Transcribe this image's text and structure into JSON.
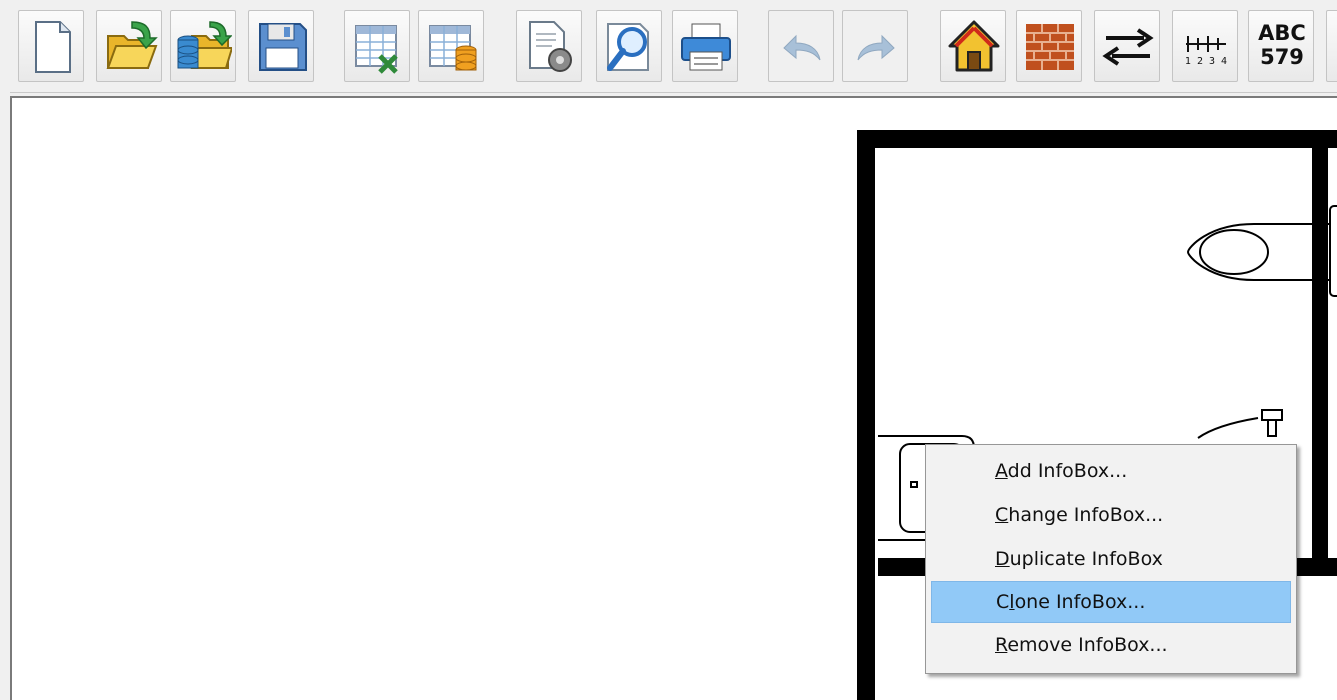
{
  "toolbar": {
    "buttons": [
      {
        "name": "new-document-button",
        "icon": "new-document-icon"
      },
      {
        "name": "open-file-button",
        "icon": "open-folder-icon"
      },
      {
        "name": "open-database-button",
        "icon": "open-database-icon"
      },
      {
        "name": "save-button",
        "icon": "floppy-disk-icon"
      },
      {
        "name": "export-excel-button",
        "icon": "excel-table-icon"
      },
      {
        "name": "export-database-button",
        "icon": "database-table-icon"
      },
      {
        "name": "page-settings-button",
        "icon": "settings-document-icon"
      },
      {
        "name": "print-preview-button",
        "icon": "magnifier-icon"
      },
      {
        "name": "print-button",
        "icon": "printer-icon"
      },
      {
        "name": "undo-button",
        "icon": "undo-icon",
        "disabled": true
      },
      {
        "name": "redo-button",
        "icon": "redo-icon",
        "disabled": true
      },
      {
        "name": "home-button",
        "icon": "house-icon"
      },
      {
        "name": "wall-button",
        "icon": "brick-wall-icon"
      },
      {
        "name": "swap-button",
        "icon": "swap-arrows-icon"
      },
      {
        "name": "ruler-button",
        "icon": "ruler-icon"
      },
      {
        "name": "numbering-button",
        "icon": "abc-numbers-icon"
      }
    ],
    "ruler_digits": "1 2 3 4",
    "abc_label": "ABC",
    "num_label": "579"
  },
  "context_menu": {
    "items": [
      {
        "pre": "",
        "key": "A",
        "post": "dd InfoBox...",
        "highlighted": false
      },
      {
        "pre": "",
        "key": "C",
        "post": "hange InfoBox...",
        "highlighted": false
      },
      {
        "pre": "",
        "key": "D",
        "post": "uplicate InfoBox",
        "highlighted": false
      },
      {
        "pre": "C",
        "key": "l",
        "post": "one InfoBox...",
        "highlighted": true
      },
      {
        "pre": "",
        "key": "R",
        "post": "emove InfoBox...",
        "highlighted": false
      }
    ]
  },
  "colors": {
    "highlight": "#91c9f7",
    "menu_bg": "#f2f2f2",
    "wall": "#000000"
  }
}
